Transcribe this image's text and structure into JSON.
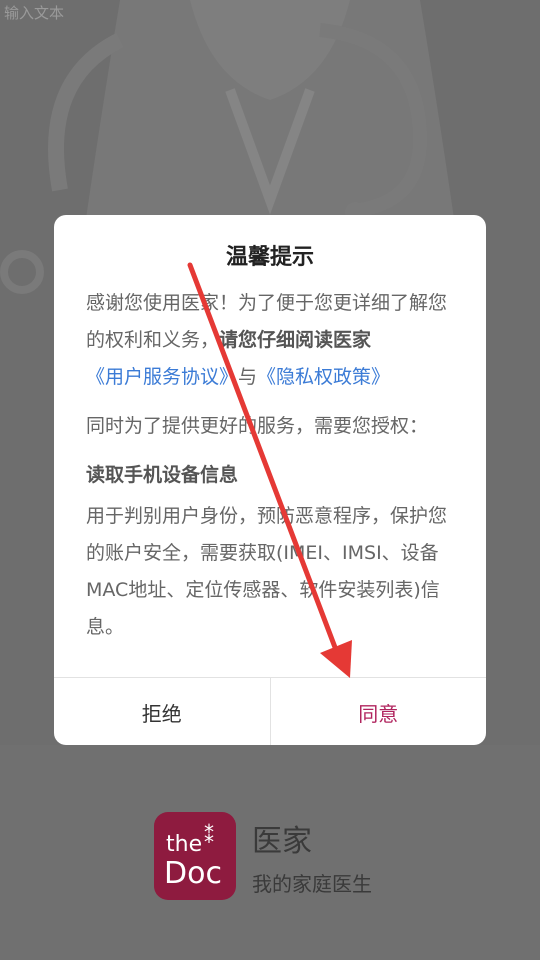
{
  "background": {
    "top_text": "输入文本"
  },
  "dialog": {
    "title": "温馨提示",
    "para1_normal": "感谢您使用医家！为了便于您更详细了解您的权利和义务，",
    "para1_bold": "请您仔细阅读医家",
    "link_user_agreement": "《用户服务协议》",
    "connector": "与",
    "link_privacy": "《隐私权政策》",
    "para2": "同时为了提供更好的服务，需要您授权：",
    "permission_title": "读取手机设备信息",
    "permission_desc": "用于判别用户身份，预防恶意程序，保护您的账户安全，需要获取(IMEI、IMSI、设备MAC地址、定位传感器、软件安装列表)信息。",
    "reject_label": "拒绝",
    "agree_label": "同意"
  },
  "brand": {
    "logo_the": "the",
    "logo_doc": "Doc",
    "name": "医家",
    "slogan": "我的家庭医生"
  },
  "colors": {
    "overlay": "#6e6e6e",
    "link": "#3b7bd6",
    "agree": "#b0245e",
    "logo": "#8e1b3f",
    "arrow": "#e53935"
  }
}
